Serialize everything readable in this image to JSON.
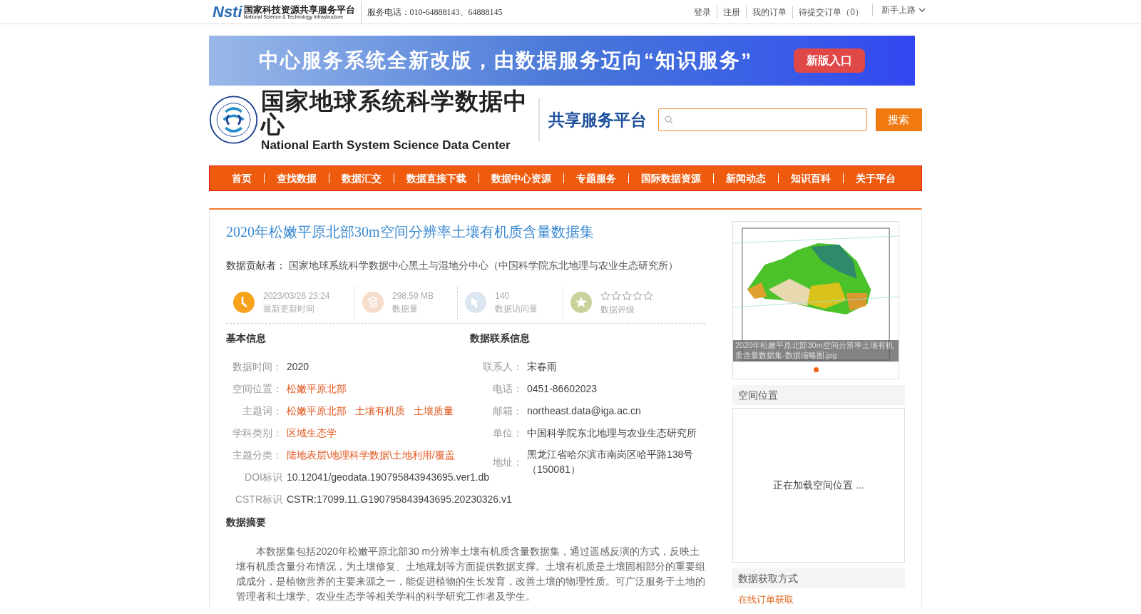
{
  "top_bar": {
    "logo_mark": "Nsti",
    "logo_title": "国家科技资源共享服务平台",
    "logo_subtitle": "National Science & Technology Infrastructure",
    "phone": "服务电话：010-64888143、64888145",
    "links": [
      "登录",
      "注册",
      "我的订单",
      "待提交订单（0）"
    ],
    "guide": "新手上路"
  },
  "banner": {
    "headline": "中心服务系统全新改版，由数据服务迈向“知识服务”",
    "button": "新版入口"
  },
  "header": {
    "title": "国家地球系统科学数据中心",
    "subtitle": "National Earth System Science Data Center",
    "platform": "共享服务平台",
    "search_button": "搜索"
  },
  "nav": [
    "首页",
    "查找数据",
    "数据汇交",
    "数据直接下载",
    "数据中心资源",
    "专题服务",
    "国际数据资源",
    "新闻动态",
    "知识百科",
    "关于平台"
  ],
  "dataset": {
    "title": "2020年松嫩平原北部30m空间分辨率土壤有机质含量数据集",
    "contributor_label": "数据贡献者：",
    "contributor": "国家地球系统科学数据中心黑土与湿地分中心（中国科学院东北地理与农业生态研究所）",
    "stats": [
      {
        "kind": "clock",
        "value": "2023/03/26 23:24",
        "label": "最新更新时间"
      },
      {
        "kind": "layers",
        "value": "298.59 MB",
        "label": "数据量"
      },
      {
        "kind": "cursor",
        "value": "140",
        "label": "数据访问量"
      },
      {
        "kind": "rating",
        "stars": 0,
        "label": "数据评级"
      }
    ]
  },
  "basic_info": {
    "heading": "基本信息",
    "fields": [
      {
        "kind": "text",
        "label": "数据时间：",
        "value": "2020"
      },
      {
        "kind": "links",
        "label": "空间位置：",
        "links": [
          "松嫩平原北部"
        ]
      },
      {
        "kind": "links",
        "label": "主题词：",
        "links": [
          "松嫩平原北部",
          "土壤有机质",
          "土壤质量"
        ]
      },
      {
        "kind": "links",
        "label": "学科类别：",
        "links": [
          "区域生态学"
        ]
      },
      {
        "kind": "links",
        "label": "主题分类：",
        "links": [
          "陆地表层\\地理科学数据\\土地利用/覆盖"
        ]
      },
      {
        "kind": "text",
        "label": "DOI标识",
        "value": "10.12041/geodata.190795843943695.ver1.db"
      },
      {
        "kind": "text",
        "label": "CSTR标识",
        "value": "CSTR:17099.11.G190795843943695.20230326.v1"
      }
    ]
  },
  "contact": {
    "heading": "数据联系信息",
    "fields": [
      {
        "label": "联系人：",
        "value": "宋春雨"
      },
      {
        "label": "电话：",
        "value": "0451-86602023"
      },
      {
        "label": "邮箱：",
        "value": "northeast.data@iga.ac.cn"
      },
      {
        "label": "单位：",
        "value": "中国科学院东北地理与农业生态研究所"
      },
      {
        "label": "地址：",
        "value": "黑龙江省哈尔滨市南岗区哈平路138号（150081）"
      }
    ]
  },
  "abstract": {
    "heading": "数据摘要",
    "text": "本数据集包括2020年松嫩平原北部30 m分辨率土壤有机质含量数据集，通过遥感反演的方式，反映土壤有机质含量分布情况，为土壤修复、土地规划等方面提供数据支撑。土壤有机质是土壤固相部分的重要组成成分，是植物营养的主要来源之一，能促进植物的生长发育，改善土壤的物理性质。可广泛服务于土地的管理者和土壤学、农业生态学等相关学科的科学研究工作者及学生。"
  },
  "sidebar": {
    "thumbnail_caption": "2020年松嫩平原北部30m空间分辨率土壤有机质含量数据集-数据缩略图.jpg",
    "carousel_dots": [
      {
        "selected": true
      }
    ],
    "location_heading": "空间位置",
    "location_loading": "正在加载空间位置 ...",
    "access_heading": "数据获取方式",
    "access_link": "在线订单获取"
  }
}
